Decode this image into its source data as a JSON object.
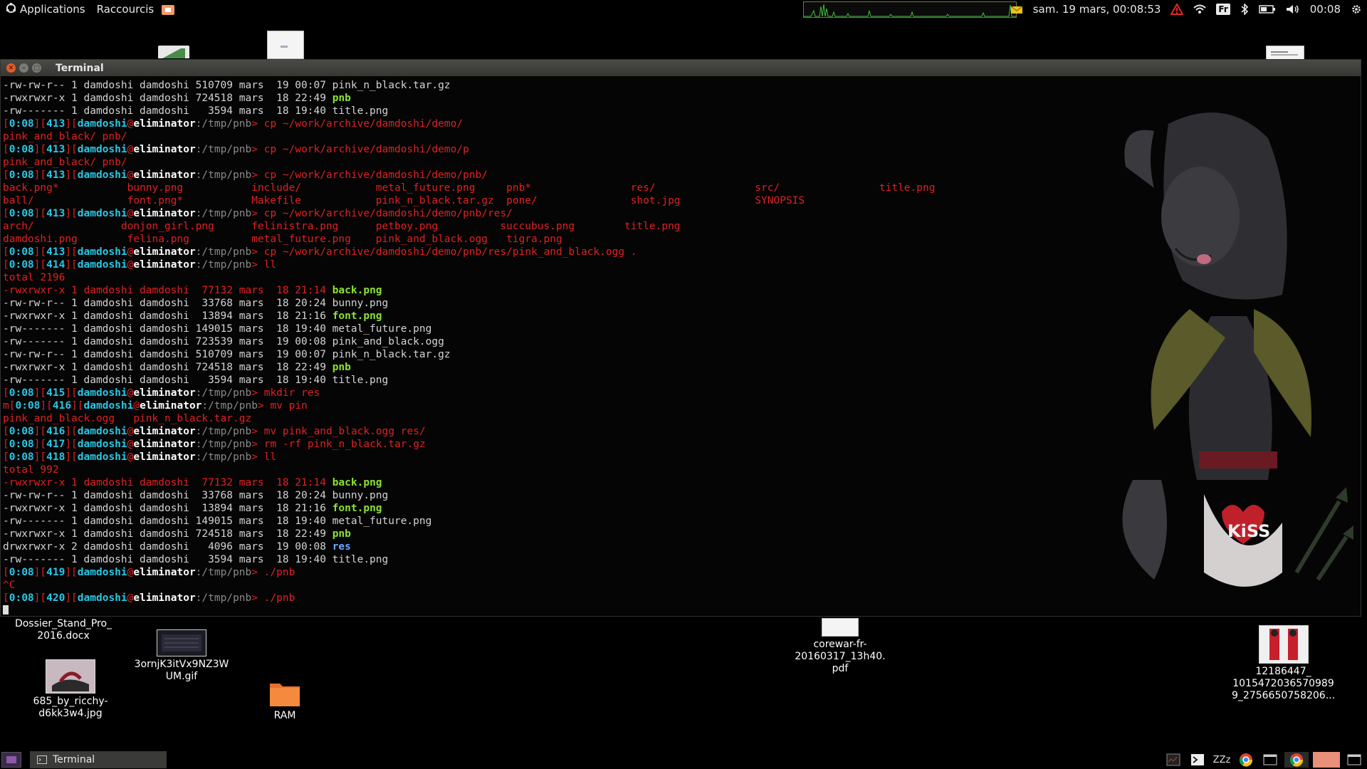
{
  "top_panel": {
    "applications_label": "Applications",
    "shortcuts_label": "Raccourcis",
    "datetime": "sam. 19 mars, 00:08:53",
    "keyboard_layout": "Fr",
    "clock": "00:08"
  },
  "window": {
    "title": "Terminal"
  },
  "terminal": {
    "lines": [
      [
        [
          "w",
          "-rw-rw-r-- 1 damdoshi damdoshi 510709 mars  19 00:07 pink_n_black.tar.gz"
        ]
      ],
      [
        [
          "w",
          "-rwxrwxr-x 1 damdoshi damdoshi 724518 mars  18 22:49 "
        ],
        [
          "g",
          "pnb"
        ]
      ],
      [
        [
          "w",
          "-rw------- 1 damdoshi damdoshi   3594 mars  18 19:40 title.png"
        ]
      ],
      [
        [
          "r",
          "["
        ],
        [
          "c",
          "0:08"
        ],
        [
          "r",
          "]["
        ],
        [
          "c",
          "413"
        ],
        [
          "r",
          "]["
        ],
        [
          "c",
          "damdoshi"
        ],
        [
          "r",
          "@"
        ],
        [
          "wb",
          "eliminator"
        ],
        [
          "gr",
          ":/tmp/pnb"
        ],
        [
          "r",
          "> cp ~/work/archive/damdoshi/demo/"
        ]
      ],
      [
        [
          "r",
          "pink_and_black/ pnb/"
        ]
      ],
      [
        [
          "r",
          "["
        ],
        [
          "c",
          "0:08"
        ],
        [
          "r",
          "]["
        ],
        [
          "c",
          "413"
        ],
        [
          "r",
          "]["
        ],
        [
          "c",
          "damdoshi"
        ],
        [
          "r",
          "@"
        ],
        [
          "wb",
          "eliminator"
        ],
        [
          "gr",
          ":/tmp/pnb"
        ],
        [
          "r",
          "> cp ~/work/archive/damdoshi/demo/p"
        ]
      ],
      [
        [
          "r",
          "pink_and_black/ pnb/"
        ]
      ],
      [
        [
          "r",
          "["
        ],
        [
          "c",
          "0:08"
        ],
        [
          "r",
          "]["
        ],
        [
          "c",
          "413"
        ],
        [
          "r",
          "]["
        ],
        [
          "c",
          "damdoshi"
        ],
        [
          "r",
          "@"
        ],
        [
          "wb",
          "eliminator"
        ],
        [
          "gr",
          ":/tmp/pnb"
        ],
        [
          "r",
          "> cp ~/work/archive/damdoshi/demo/pnb/"
        ]
      ],
      [
        [
          "r",
          "back.png*           bunny.png           include/            metal_future.png     pnb*                res/                src/                title.png"
        ]
      ],
      [
        [
          "r",
          "ball/               font.png*           Makefile            pink_n_black.tar.gz  pone/               shot.jpg            SYNOPSIS"
        ]
      ],
      [
        [
          "r",
          "["
        ],
        [
          "c",
          "0:08"
        ],
        [
          "r",
          "]["
        ],
        [
          "c",
          "413"
        ],
        [
          "r",
          "]["
        ],
        [
          "c",
          "damdoshi"
        ],
        [
          "r",
          "@"
        ],
        [
          "wb",
          "eliminator"
        ],
        [
          "gr",
          ":/tmp/pnb"
        ],
        [
          "r",
          "> cp ~/work/archive/damdoshi/demo/pnb/res/"
        ]
      ],
      [
        [
          "r",
          "arch/              donjon_girl.png      felinistra.png      petboy.png          succubus.png        title.png"
        ]
      ],
      [
        [
          "r",
          "damdoshi.png        felina.png          metal_future.png    pink_and_black.ogg   tigra.png"
        ]
      ],
      [
        [
          "r",
          "["
        ],
        [
          "c",
          "0:08"
        ],
        [
          "r",
          "]["
        ],
        [
          "c",
          "413"
        ],
        [
          "r",
          "]["
        ],
        [
          "c",
          "damdoshi"
        ],
        [
          "r",
          "@"
        ],
        [
          "wb",
          "eliminator"
        ],
        [
          "gr",
          ":/tmp/pnb"
        ],
        [
          "r",
          "> cp ~/work/archive/damdoshi/demo/pnb/res/pink_and_black.ogg ."
        ]
      ],
      [
        [
          "r",
          "["
        ],
        [
          "c",
          "0:08"
        ],
        [
          "r",
          "]["
        ],
        [
          "c",
          "414"
        ],
        [
          "r",
          "]["
        ],
        [
          "c",
          "damdoshi"
        ],
        [
          "r",
          "@"
        ],
        [
          "wb",
          "eliminator"
        ],
        [
          "gr",
          ":/tmp/pnb"
        ],
        [
          "r",
          "> ll"
        ]
      ],
      [
        [
          "r",
          "total 2196"
        ]
      ],
      [
        [
          "r",
          "-rwxrwxr-x 1 damdoshi damdoshi  77132 mars  18 21:14 "
        ],
        [
          "g",
          "back.png"
        ]
      ],
      [
        [
          "w",
          "-rw-rw-r-- 1 damdoshi damdoshi  33768 mars  18 20:24 bunny.png"
        ]
      ],
      [
        [
          "w",
          "-rwxrwxr-x 1 damdoshi damdoshi  13894 mars  18 21:16 "
        ],
        [
          "g",
          "font.png"
        ]
      ],
      [
        [
          "w",
          "-rw------- 1 damdoshi damdoshi 149015 mars  18 19:40 metal_future.png"
        ]
      ],
      [
        [
          "w",
          "-rw------- 1 damdoshi damdoshi 723539 mars  19 00:08 pink_and_black.ogg"
        ]
      ],
      [
        [
          "w",
          "-rw-rw-r-- 1 damdoshi damdoshi 510709 mars  19 00:07 pink_n_black.tar.gz"
        ]
      ],
      [
        [
          "w",
          "-rwxrwxr-x 1 damdoshi damdoshi 724518 mars  18 22:49 "
        ],
        [
          "g",
          "pnb"
        ]
      ],
      [
        [
          "w",
          "-rw------- 1 damdoshi damdoshi   3594 mars  18 19:40 title.png"
        ]
      ],
      [
        [
          "r",
          "["
        ],
        [
          "c",
          "0:08"
        ],
        [
          "r",
          "]["
        ],
        [
          "c",
          "415"
        ],
        [
          "r",
          "]["
        ],
        [
          "c",
          "damdoshi"
        ],
        [
          "r",
          "@"
        ],
        [
          "wb",
          "eliminator"
        ],
        [
          "gr",
          ":/tmp/pnb"
        ],
        [
          "r",
          "> mkdir res"
        ]
      ],
      [
        [
          "r",
          "m["
        ],
        [
          "c",
          "0:08"
        ],
        [
          "r",
          "]["
        ],
        [
          "c",
          "416"
        ],
        [
          "r",
          "]["
        ],
        [
          "c",
          "damdoshi"
        ],
        [
          "r",
          "@"
        ],
        [
          "wb",
          "eliminator"
        ],
        [
          "gr",
          ":/tmp/pnb"
        ],
        [
          "r",
          "> mv pin"
        ]
      ],
      [
        [
          "r",
          "pink_and_black.ogg   pink_n_black.tar.gz"
        ]
      ],
      [
        [
          "r",
          "["
        ],
        [
          "c",
          "0:08"
        ],
        [
          "r",
          "]["
        ],
        [
          "c",
          "416"
        ],
        [
          "r",
          "]["
        ],
        [
          "c",
          "damdoshi"
        ],
        [
          "r",
          "@"
        ],
        [
          "wb",
          "eliminator"
        ],
        [
          "gr",
          ":/tmp/pnb"
        ],
        [
          "r",
          "> mv pink_and_black.ogg res/"
        ]
      ],
      [
        [
          "r",
          "["
        ],
        [
          "c",
          "0:08"
        ],
        [
          "r",
          "]["
        ],
        [
          "c",
          "417"
        ],
        [
          "r",
          "]["
        ],
        [
          "c",
          "damdoshi"
        ],
        [
          "r",
          "@"
        ],
        [
          "wb",
          "eliminator"
        ],
        [
          "gr",
          ":/tmp/pnb"
        ],
        [
          "r",
          "> rm -rf pink_n_black.tar.gz"
        ]
      ],
      [
        [
          "r",
          "["
        ],
        [
          "c",
          "0:08"
        ],
        [
          "r",
          "]["
        ],
        [
          "c",
          "418"
        ],
        [
          "r",
          "]["
        ],
        [
          "c",
          "damdoshi"
        ],
        [
          "r",
          "@"
        ],
        [
          "wb",
          "eliminator"
        ],
        [
          "gr",
          ":/tmp/pnb"
        ],
        [
          "r",
          "> ll"
        ]
      ],
      [
        [
          "r",
          "total 992"
        ]
      ],
      [
        [
          "r",
          "-rwxrwxr-x 1 damdoshi damdoshi  77132 mars  18 21:14 "
        ],
        [
          "g",
          "back.png"
        ]
      ],
      [
        [
          "w",
          "-rw-rw-r-- 1 damdoshi damdoshi  33768 mars  18 20:24 bunny.png"
        ]
      ],
      [
        [
          "w",
          "-rwxrwxr-x 1 damdoshi damdoshi  13894 mars  18 21:16 "
        ],
        [
          "g",
          "font.png"
        ]
      ],
      [
        [
          "w",
          "-rw------- 1 damdoshi damdoshi 149015 mars  18 19:40 metal_future.png"
        ]
      ],
      [
        [
          "w",
          "-rwxrwxr-x 1 damdoshi damdoshi 724518 mars  18 22:49 "
        ],
        [
          "g",
          "pnb"
        ]
      ],
      [
        [
          "w",
          "drwxrwxr-x 2 damdoshi damdoshi   4096 mars  19 00:08 "
        ],
        [
          "b",
          "res"
        ]
      ],
      [
        [
          "w",
          "-rw------- 1 damdoshi damdoshi   3594 mars  18 19:40 title.png"
        ]
      ],
      [
        [
          "r",
          "["
        ],
        [
          "c",
          "0:08"
        ],
        [
          "r",
          "]["
        ],
        [
          "c",
          "419"
        ],
        [
          "r",
          "]["
        ],
        [
          "c",
          "damdoshi"
        ],
        [
          "r",
          "@"
        ],
        [
          "wb",
          "eliminator"
        ],
        [
          "gr",
          ":/tmp/pnb"
        ],
        [
          "r",
          "> ./pnb"
        ]
      ],
      [
        [
          "r",
          "^C"
        ]
      ],
      [
        [
          "r",
          "["
        ],
        [
          "c",
          "0:08"
        ],
        [
          "r",
          "]["
        ],
        [
          "c",
          "420"
        ],
        [
          "r",
          "]["
        ],
        [
          "c",
          "damdoshi"
        ],
        [
          "r",
          "@"
        ],
        [
          "wb",
          "eliminator"
        ],
        [
          "gr",
          ":/tmp/pnb"
        ],
        [
          "r",
          "> ./pnb"
        ]
      ]
    ],
    "colors": {
      "r": "#e02020",
      "w": "#d4d4d4",
      "c": "#29c7e6",
      "g": "#8ae234",
      "b": "#6fa8ff",
      "wb": "#ffffff",
      "gr": "#8a8a8a"
    }
  },
  "desktop_icons": {
    "docx": "Dossier_Stand_Pro_\n2016.docx",
    "gif": "3ornjK3itVx9NZ3W\nUM.gif",
    "jpg": "685_by_ricchy-\nd6kk3w4.jpg",
    "ram": "RAM",
    "pdf": "corewar-fr-\n20160317_13h40.\npdf",
    "img": "12186447_\n1015472036570989\n9_2756650758206..."
  },
  "bottom_panel": {
    "task_terminal_label": "Terminal"
  },
  "accent_colors": {
    "prompt_red": "#e02020",
    "prompt_cyan": "#29c7e6",
    "exec_green": "#8ae234",
    "close_button": "#e45b2b"
  }
}
